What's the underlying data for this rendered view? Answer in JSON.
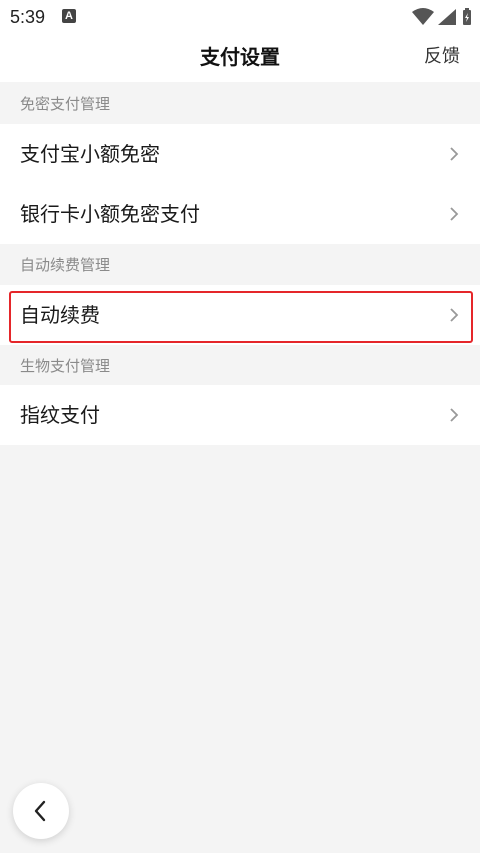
{
  "status_bar": {
    "time": "5:39",
    "notification_icon": "a-box-icon",
    "icons": [
      "wifi-icon",
      "signal-icon",
      "battery-charging-icon"
    ]
  },
  "header": {
    "title": "支付设置",
    "feedback_label": "反馈"
  },
  "sections": [
    {
      "label": "免密支付管理",
      "items": [
        {
          "label": "支付宝小额免密"
        },
        {
          "label": "银行卡小额免密支付"
        }
      ]
    },
    {
      "label": "自动续费管理",
      "items": [
        {
          "label": "自动续费",
          "highlighted": true
        }
      ]
    },
    {
      "label": "生物支付管理",
      "items": [
        {
          "label": "指纹支付"
        }
      ]
    }
  ],
  "back_button": {
    "icon": "chevron-left-icon"
  },
  "colors": {
    "background": "#f4f4f4",
    "row_background": "#ffffff",
    "highlight_border": "#e5262a",
    "section_label": "#8a8a8a"
  }
}
